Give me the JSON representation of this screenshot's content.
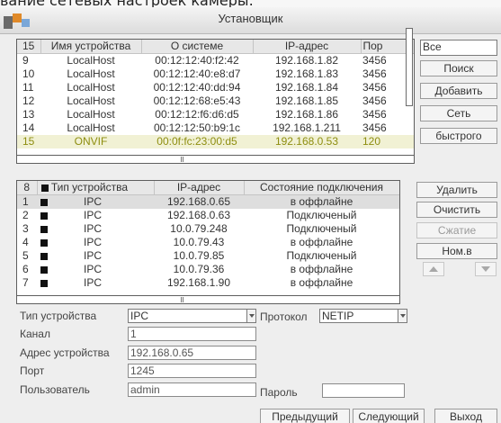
{
  "caption_fragment": "вание сетевых настроек камеры:",
  "window": {
    "title": "Установщик"
  },
  "search_panel": {
    "header": {
      "count": "15",
      "name": "Имя устройства",
      "system": "О системе",
      "ip": "IP-адрес",
      "port": "Пор"
    },
    "rows": [
      {
        "num": "9",
        "name": "LocalHost",
        "mac": "00:12:12:40:f2:42",
        "ip": "192.168.1.82",
        "port": "3456"
      },
      {
        "num": "10",
        "name": "LocalHost",
        "mac": "00:12:12:40:e8:d7",
        "ip": "192.168.1.83",
        "port": "3456"
      },
      {
        "num": "11",
        "name": "LocalHost",
        "mac": "00:12:12:40:dd:94",
        "ip": "192.168.1.84",
        "port": "3456"
      },
      {
        "num": "12",
        "name": "LocalHost",
        "mac": "00:12:12:68:e5:43",
        "ip": "192.168.1.85",
        "port": "3456"
      },
      {
        "num": "13",
        "name": "LocalHost",
        "mac": "00:12:12:f6:d6:d5",
        "ip": "192.168.1.86",
        "port": "3456"
      },
      {
        "num": "14",
        "name": "LocalHost",
        "mac": "00:12:12:50:b9:1c",
        "ip": "192.168.1.211",
        "port": "3456"
      },
      {
        "num": "15",
        "name": "ONVIF",
        "mac": "00:0f:fc:23:00:d5",
        "ip": "192.168.0.53",
        "port": "120"
      }
    ],
    "filter_value": "Все",
    "buttons": {
      "search": "Поиск",
      "add": "Добавить",
      "network": "Сеть",
      "quick": "быстрого"
    }
  },
  "added_panel": {
    "header": {
      "count": "8",
      "type": "Тип устройства",
      "ip": "IP-адрес",
      "status": "Состояние подключения"
    },
    "rows": [
      {
        "num": "1",
        "type": "IPC",
        "ip": "192.168.0.65",
        "status": "в оффлайне"
      },
      {
        "num": "2",
        "type": "IPC",
        "ip": "192.168.0.63",
        "status": "Подключеный"
      },
      {
        "num": "3",
        "type": "IPC",
        "ip": "10.0.79.248",
        "status": "Подключеный"
      },
      {
        "num": "4",
        "type": "IPC",
        "ip": "10.0.79.43",
        "status": "в оффлайне"
      },
      {
        "num": "5",
        "type": "IPC",
        "ip": "10.0.79.85",
        "status": "Подключеный"
      },
      {
        "num": "6",
        "type": "IPC",
        "ip": "10.0.79.36",
        "status": "в оффлайне"
      },
      {
        "num": "7",
        "type": "IPC",
        "ip": "192.168.1.90",
        "status": "в оффлайне"
      }
    ],
    "buttons": {
      "delete": "Удалить",
      "clear": "Очистить",
      "compress": "Сжатие",
      "renumber": "Ном.в"
    }
  },
  "form": {
    "device_type": {
      "label": "Тип устройства",
      "value": "IPC"
    },
    "protocol": {
      "label": "Протокол",
      "value": "NETIP"
    },
    "channel": {
      "label": "Канал",
      "value": "1"
    },
    "address": {
      "label": "Адрес устройства",
      "value": "192.168.0.65"
    },
    "port": {
      "label": "Порт",
      "value": "1245"
    },
    "user": {
      "label": "Пользователь",
      "value": "admin"
    },
    "password": {
      "label": "Пароль",
      "value": ""
    }
  },
  "footer": {
    "prev": "Предыдущий",
    "next": "Следующий",
    "exit": "Выход"
  },
  "colors": {
    "selected_row_text": "#8e8e10",
    "selected_row_bg": "#f1f1d4",
    "highlight_row_bg": "#dedede",
    "brand_orange": "#e08a2a"
  }
}
